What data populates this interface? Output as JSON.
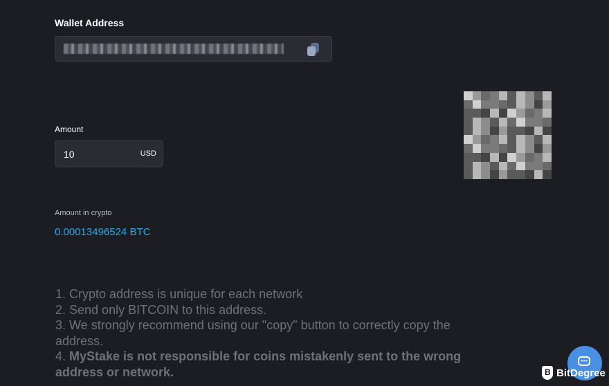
{
  "wallet": {
    "label": "Wallet Address"
  },
  "amount": {
    "label": "Amount",
    "value": "10",
    "currency": "USD"
  },
  "crypto": {
    "label": "Amount in crypto",
    "value": "0.00013496524 BTC"
  },
  "notes": {
    "line1": "1. Crypto address is unique for each network",
    "line2": "2. Send only BITCOIN to this address.",
    "line3a": "3. We strongly recommend using our \"copy\" button to correctly copy the",
    "line3b": "address.",
    "line4_prefix": "4. ",
    "line4_bold_a": "MyStake is not responsible for coins mistakenly sent to the wrong",
    "line4_bold_b": "address or network."
  },
  "watermark": {
    "text": "BitDegree"
  },
  "colors": {
    "background": "#1c1d22",
    "input_bg": "#2a2b33",
    "accent_crypto": "#2aa7e8",
    "chat_button": "#4a90e2",
    "notes_text": "#6e7077"
  },
  "icons": {
    "copy": "copy-icon",
    "chat": "chat-icon",
    "qr": "qr-code-icon",
    "brand": "bitdegree-shield-icon"
  }
}
